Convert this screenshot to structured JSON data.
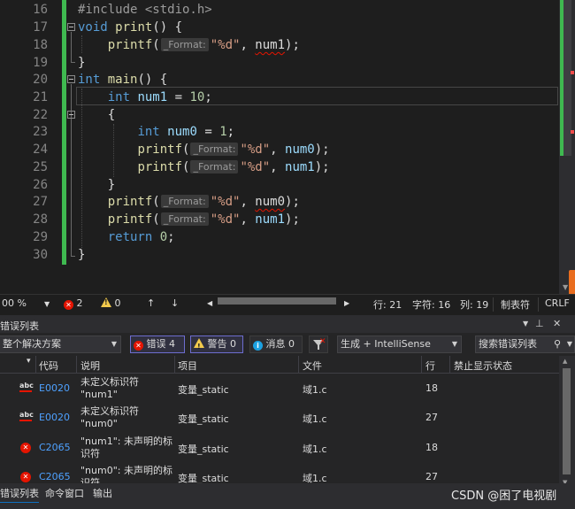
{
  "editor": {
    "line_numbers": [
      "16",
      "17",
      "18",
      "19",
      "20",
      "21",
      "22",
      "23",
      "24",
      "25",
      "26",
      "27",
      "28",
      "29",
      "30"
    ],
    "param_hint": "_Format:",
    "include_line": "#include <stdio.h>",
    "tok": {
      "void": "void",
      "int": "int",
      "return": "return",
      "print": "print",
      "main": "main",
      "printf": "printf",
      "num1": "num1",
      "num0": "num0",
      "fmt": "\"%d\"",
      "ten": "10",
      "one": "1",
      "zero": "0"
    }
  },
  "statusbar": {
    "zoom": "00 %",
    "error_count": "2",
    "warning_count": "0",
    "line": "行: 21",
    "char": "字符: 16",
    "col": "列: 19",
    "tabs": "制表符",
    "eol": "CRLF"
  },
  "panel": {
    "title": "错误列表",
    "scope": "整个解决方案",
    "errors_btn": "错误 4",
    "warnings_btn": "警告 0",
    "messages_btn": "消息 0",
    "build_filter": "生成 + IntelliSense",
    "search_placeholder": "搜索错误列表",
    "columns": [
      "代码",
      "说明",
      "项目",
      "文件",
      "行",
      "禁止显示状态"
    ],
    "rows": [
      {
        "icon": "abc",
        "code": "E0020",
        "desc": "未定义标识符 \"num1\"",
        "project": "变量_static",
        "file": "域1.c",
        "line": "18"
      },
      {
        "icon": "abc",
        "code": "E0020",
        "desc": "未定义标识符 \"num0\"",
        "project": "变量_static",
        "file": "域1.c",
        "line": "27"
      },
      {
        "icon": "error",
        "code": "C2065",
        "desc": "\"num1\": 未声明的标识符",
        "project": "变量_static",
        "file": "域1.c",
        "line": "18"
      },
      {
        "icon": "error",
        "code": "C2065",
        "desc": "\"num0\": 未声明的标识符",
        "project": "变量_static",
        "file": "域1.c",
        "line": "27"
      }
    ],
    "tabs": [
      "错误列表",
      "命令窗口",
      "输出"
    ]
  },
  "watermark": "CSDN @困了电视剧",
  "colors": {
    "background": "#1e1e1e",
    "keyword": "#569cd6",
    "function": "#dcdcaa",
    "string": "#d69d85",
    "number": "#b5cea8",
    "changebar": "#3fb950",
    "error": "#e51400"
  }
}
